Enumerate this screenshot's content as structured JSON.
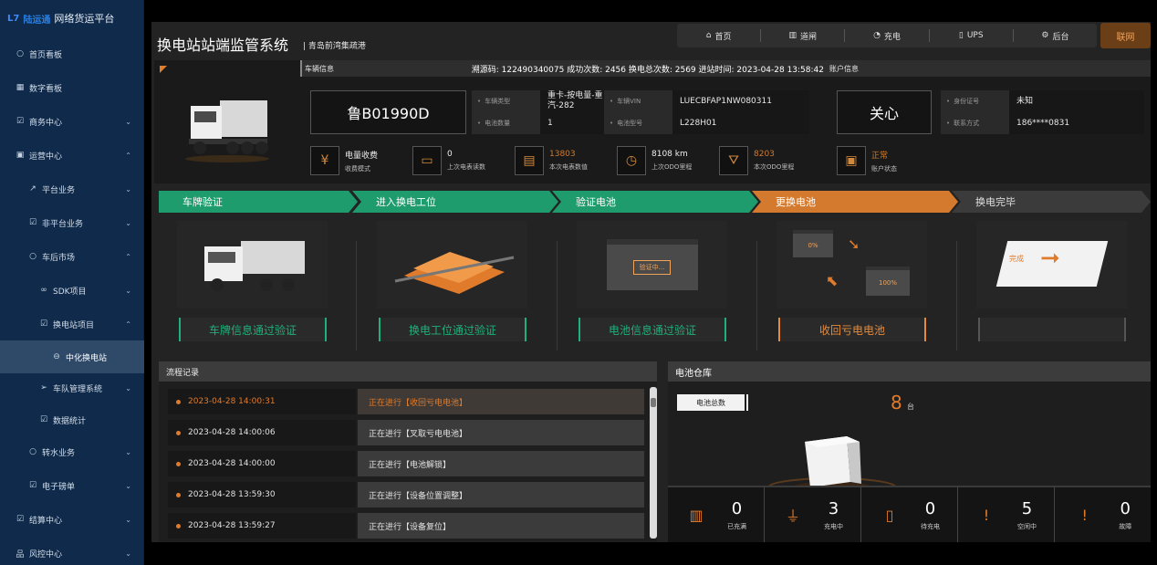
{
  "brand": {
    "logo": "L7",
    "name": "陆运通",
    "title": "网络货运平台"
  },
  "sidebar": {
    "items": [
      {
        "icon": "○",
        "label": "首页看板",
        "chev": ""
      },
      {
        "icon": "▦",
        "label": "数字看板",
        "chev": ""
      },
      {
        "icon": "☑",
        "label": "商务中心",
        "chev": "⌄"
      },
      {
        "icon": "▣",
        "label": "运营中心",
        "chev": "⌃"
      },
      {
        "icon": "↗",
        "label": "平台业务",
        "chev": "⌄"
      },
      {
        "icon": "☑",
        "label": "非平台业务",
        "chev": "⌄"
      },
      {
        "icon": "○",
        "label": "车后市场",
        "chev": "⌃"
      },
      {
        "icon": "∞",
        "label": "SDK项目",
        "chev": "⌄"
      },
      {
        "icon": "☑",
        "label": "换电站项目",
        "chev": "⌃"
      },
      {
        "icon": "⊖",
        "label": "中化换电站",
        "chev": ""
      },
      {
        "icon": "➢",
        "label": "车队管理系统",
        "chev": "⌄"
      },
      {
        "icon": "☑",
        "label": "数据统计",
        "chev": ""
      },
      {
        "icon": "○",
        "label": "转水业务",
        "chev": "⌄"
      },
      {
        "icon": "☑",
        "label": "电子磅单",
        "chev": "⌄"
      },
      {
        "icon": "☑",
        "label": "结算中心",
        "chev": "⌄"
      },
      {
        "icon": "品",
        "label": "风控中心",
        "chev": "⌄"
      }
    ]
  },
  "header": {
    "title": "换电站站端监管系统",
    "subtitle": "| 青岛前湾集疏港",
    "nav": [
      {
        "icon": "⌂",
        "label": "首页"
      },
      {
        "icon": "▥",
        "label": "道闸"
      },
      {
        "icon": "◔",
        "label": "充电"
      },
      {
        "icon": "▯",
        "label": "UPS"
      },
      {
        "icon": "⚙",
        "label": "后台"
      }
    ],
    "online": "联网"
  },
  "vehicle": {
    "head_label": "车辆信息",
    "head_info": "溯源码: 122490340075 成功次数: 2456 换电总次数: 2569 进站时间: 2023-04-28 13:58:42",
    "account_label": "账户信息",
    "plate": "鲁B01990D",
    "fields": [
      {
        "k": "车辆类型",
        "v": "重卡-按电量-重汽-282"
      },
      {
        "k": "车辆VIN",
        "v": "LUECBFAP1NW080311"
      },
      {
        "k": "电池数量",
        "v": "1"
      },
      {
        "k": "电池型号",
        "v": "L228H01"
      }
    ],
    "driver_name": "关心",
    "account_fields": [
      {
        "k": "身份证号",
        "v": "未知"
      },
      {
        "k": "联系方式",
        "v": "186****0831"
      }
    ],
    "stats": [
      {
        "icon": "¥",
        "a": "电量收费",
        "b": "收费模式",
        "orange": false
      },
      {
        "icon": "▭",
        "a": "0",
        "b": "上次电表读数",
        "orange": false
      },
      {
        "icon": "▤",
        "a": "13803",
        "b": "本次电表数值",
        "orange": true
      },
      {
        "icon": "◷",
        "a": "8108 km",
        "b": "上次ODO里程",
        "orange": false
      },
      {
        "icon": "⛛",
        "a": "8203",
        "b": "本次ODO里程",
        "orange": true
      },
      {
        "icon": "▣",
        "a": "正常",
        "b": "账户状态",
        "orange": true
      }
    ]
  },
  "steps": [
    {
      "label": "车牌验证",
      "state": "done"
    },
    {
      "label": "进入换电工位",
      "state": "done"
    },
    {
      "label": "验证电池",
      "state": "done"
    },
    {
      "label": "更换电池",
      "state": "cur"
    },
    {
      "label": "换电完毕",
      "state": "todo"
    }
  ],
  "cards": [
    {
      "label": "车牌信息通过验证",
      "state": "g",
      "pic_text": ""
    },
    {
      "label": "换电工位通过验证",
      "state": "g",
      "pic_text": ""
    },
    {
      "label": "电池信息通过验证",
      "state": "g",
      "pic_text": "验证中..."
    },
    {
      "label": "收回亏电电池",
      "state": "o",
      "pic_text": "0%"
    },
    {
      "label": "",
      "state": "e",
      "pic_text": "完成"
    }
  ],
  "card_extra": {
    "full_pct": "100%"
  },
  "log": {
    "title": "流程记录",
    "rows": [
      {
        "time": "2023-04-28 14:00:31",
        "msg": "正在进行【收回亏电电池】",
        "active": true
      },
      {
        "time": "2023-04-28 14:00:06",
        "msg": "正在进行【叉取亏电电池】",
        "active": false
      },
      {
        "time": "2023-04-28 14:00:00",
        "msg": "正在进行【电池解锁】",
        "active": false
      },
      {
        "time": "2023-04-28 13:59:30",
        "msg": "正在进行【设备位置调整】",
        "active": false
      },
      {
        "time": "2023-04-28 13:59:27",
        "msg": "正在进行【设备复位】",
        "active": false
      }
    ]
  },
  "warehouse": {
    "title": "电池仓库",
    "total_label": "电池总数",
    "total": "8",
    "unit": "台",
    "stats": [
      {
        "icon": "▥",
        "n": "0",
        "l": "已充满"
      },
      {
        "icon": "⏚",
        "n": "3",
        "l": "充电中"
      },
      {
        "icon": "▯",
        "n": "0",
        "l": "待充电"
      },
      {
        "icon": "!",
        "n": "5",
        "l": "空闲中"
      },
      {
        "icon": "!",
        "n": "0",
        "l": "故障"
      }
    ]
  },
  "colors": {
    "accent": "#e07b2c",
    "done": "#1f9c6d",
    "sidebar": "#0f2a4a"
  }
}
